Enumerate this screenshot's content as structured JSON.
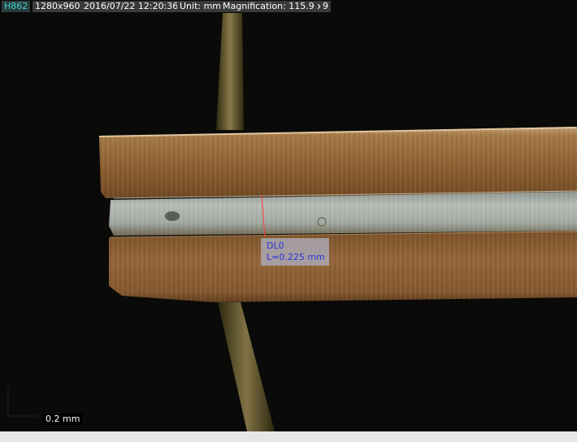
{
  "overlay": {
    "image_id": "H862",
    "resolution": "1280x960",
    "datetime": "2016/07/22 12:20:36",
    "unit": "Unit: mm",
    "magnification": "Magnification:  115.9 x",
    "frame": "9"
  },
  "measurement": {
    "name": "DL0",
    "length_label": "L=0.225 mm"
  },
  "scale_bar": {
    "label": "0.2 mm"
  },
  "colors": {
    "background": "#0a0a08",
    "copper": "#9a6a3a",
    "solder": "#a9b3ae",
    "measure_line": "#ff3a3a",
    "measure_text": "#2a35d6",
    "id_text": "#3fd3d3"
  }
}
